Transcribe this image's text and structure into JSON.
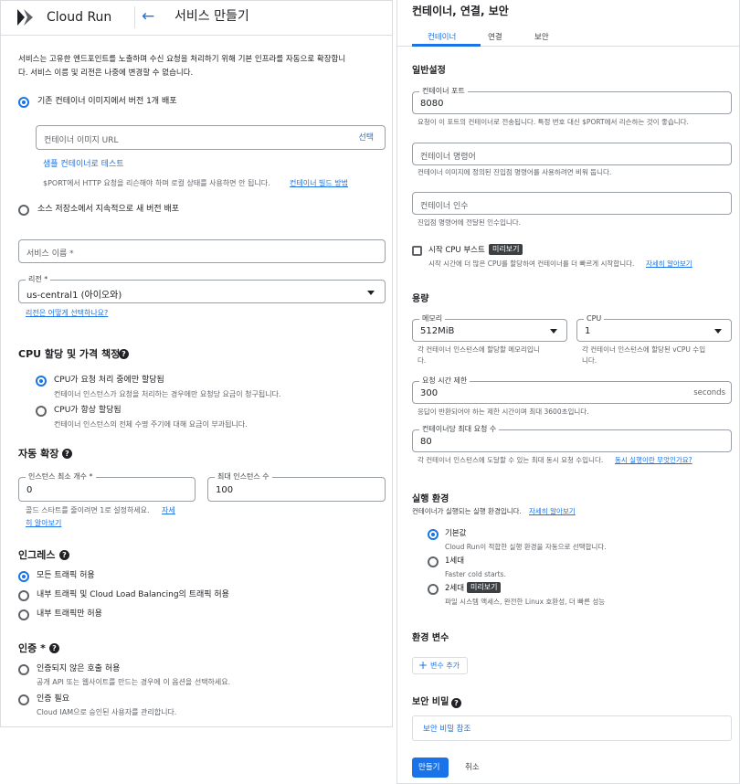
{
  "header": {
    "product": "Cloud Run",
    "page_title": "서비스 만들기"
  },
  "left": {
    "intro": [
      "서비스는 고유한 엔드포인트를 노출하며 수신 요청을 처리하기 위해 기본 인프라를 자동으로 확장합니",
      "다. 서비스 이름 및 리전은 나중에 변경할 수 없습니다."
    ],
    "deploy_options": [
      {
        "label": "기존 컨테이너 이미지에서 버전 1개 배포",
        "selected": true
      },
      {
        "label": "소스 저장소에서 지속적으로 새 버전 배포",
        "selected": false
      }
    ],
    "image_url_placeholder": "컨테이너 이미지 URL",
    "select_label": "선택",
    "sample_link": "샘플 컨테이너로 테스트",
    "port_hint": "$PORT에서 HTTP 요청을 리슨해야 하며 로컬 상태를 사용하면 안 됩니다.",
    "build_link": "컨테이너 빌드 방법",
    "service_name_label": "서비스 이름 *",
    "region_label": "리전 *",
    "region_value": "us-central1 (아이오와)",
    "region_link": "리전은 어떻게 선택하나요?",
    "cpu": {
      "title": "CPU 할당 및 가격 책정",
      "options": [
        {
          "label": "CPU가 요청 처리 중에만 할당됨",
          "desc": "컨테이너 인스턴스가 요청을 처리하는 경우에만 요청당 요금이 청구됩니다.",
          "selected": true
        },
        {
          "label": "CPU가 항상 할당됨",
          "desc": "컨테이너 인스턴스의 전체 수명 주기에 대해 요금이 부과됩니다.",
          "selected": false
        }
      ]
    },
    "autoscale": {
      "title": "자동 확장",
      "min_label": "인스턴스 최소 개수 *",
      "min_value": "0",
      "max_label": "최대 인스턴스 수",
      "max_value": "100",
      "hint_line1": "콜드 스타트를 줄이려면 1로 설정하세요.",
      "hint_link_1": "자세",
      "hint_link_2": "히 알아보기"
    },
    "ingress": {
      "title": "인그레스",
      "options": [
        {
          "label": "모든 트래픽 허용",
          "selected": true
        },
        {
          "label": "내부 트래픽 및 Cloud Load Balancing의 트래픽 허용",
          "selected": false
        },
        {
          "label": "내부 트래픽만 허용",
          "selected": false
        }
      ]
    },
    "auth": {
      "title": "인증 *",
      "options": [
        {
          "label": "인증되지 않은 호출 허용",
          "desc": "공개 API 또는 웹사이트를 만드는 경우에 이 옵션을 선택하세요.",
          "selected": false
        },
        {
          "label": "인증 필요",
          "desc": "Cloud IAM으로 승인된 사용자를 관리합니다.",
          "selected": false
        }
      ]
    }
  },
  "right": {
    "title": "컨테이너, 연결, 보안",
    "tabs": [
      "컨테이너",
      "연결",
      "보안"
    ],
    "general_title": "일반설정",
    "port_label": "컨테이너 포트",
    "port_value": "8080",
    "port_hint": "요청이 이 포트의 컨테이너로 전송됩니다. 특정 번호 대신 $PORT에서 리슨하는 것이 좋습니다.",
    "command_placeholder": "컨테이너 명령어",
    "command_hint": "컨테이너 이미지에 정의된 진입점 명령어를 사용하려면 비워 둡니다.",
    "args_placeholder": "컨테이너 인수",
    "args_hint": "진입점 명령어에 전달된 인수입니다.",
    "boost_label": "시작 CPU 부스트",
    "preview_badge": "미리보기",
    "boost_hint": "시작 시간에 더 많은 CPU를 할당하여 컨테이너를 더 빠르게 시작합니다.",
    "boost_link": "자세히 알아보기",
    "capacity_title": "용량",
    "memory_label": "메모리",
    "memory_value": "512MiB",
    "memory_hint": [
      "각 컨테이너 인스턴스에 할당할 메모리입니",
      "다."
    ],
    "cpu_label": "CPU",
    "cpu_value": "1",
    "cpu_hint": [
      "각 컨테이너 인스턴스에 할당된 vCPU 수입",
      "니다."
    ],
    "timeout_label": "요청 시간 제한",
    "timeout_value": "300",
    "timeout_unit": "seconds",
    "timeout_hint": "응답이 반환되어야 하는 제한 시간이며 최대 3600초입니다.",
    "concurrency_label": "컨테이너당 최대 요청 수",
    "concurrency_value": "80",
    "concurrency_hint": "각 컨테이너 인스턴스에 도달할 수 있는 최대 동시 요청 수입니다.",
    "concurrency_link": "동시 실행이란 무엇인가요?",
    "env_title": "실행 환경",
    "env_hint": "컨테이너가 실행되는 실행 환경입니다.",
    "env_link": "자세히 알아보기",
    "env_options": [
      {
        "label": "기본값",
        "desc": "Cloud Run이 적합한 실행 환경을 자동으로 선택합니다.",
        "selected": true,
        "badge": false
      },
      {
        "label": "1세대",
        "desc": "Faster cold starts.",
        "selected": false,
        "badge": false
      },
      {
        "label": "2세대",
        "desc": "파일 시스템 액세스, 완전한 Linux 호환성, 더 빠른 성능",
        "selected": false,
        "badge": true
      }
    ],
    "envvars_title": "환경 변수",
    "add_var_label": "변수 추가",
    "secrets_title": "보안 비밀",
    "secret_ref_label": "보안 비밀 참조",
    "create_label": "만들기",
    "cancel_label": "취소"
  }
}
